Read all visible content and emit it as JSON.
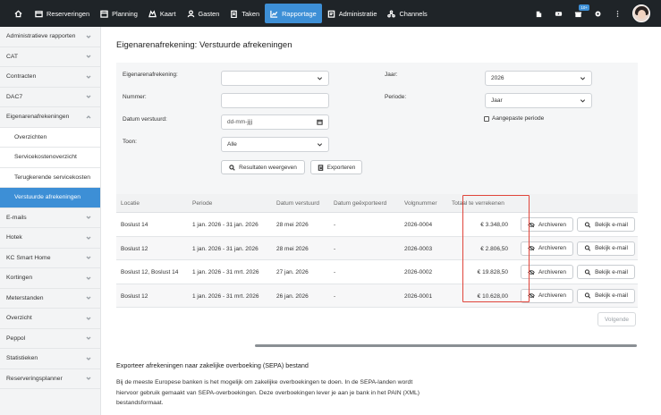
{
  "nav": {
    "items": [
      {
        "label": "Reserveringen",
        "icon": "reservations-icon"
      },
      {
        "label": "Planning",
        "icon": "planning-icon"
      },
      {
        "label": "Kaart",
        "icon": "map-icon"
      },
      {
        "label": "Gasten",
        "icon": "guests-icon"
      },
      {
        "label": "Taken",
        "icon": "tasks-icon"
      },
      {
        "label": "Rapportage",
        "icon": "chart-icon",
        "active": true
      },
      {
        "label": "Administratie",
        "icon": "admin-icon"
      },
      {
        "label": "Channels",
        "icon": "channels-icon"
      }
    ],
    "badge": "10+",
    "accent": "#3d8fd6",
    "bg": "#1f2428"
  },
  "sidebar": {
    "items": [
      {
        "label": "Administratieve rapporten"
      },
      {
        "label": "CAT"
      },
      {
        "label": "Contracten"
      },
      {
        "label": "DAC7"
      },
      {
        "label": "Eigenarenafrekeningen",
        "expanded": true
      },
      {
        "label": "Overzichten",
        "sub": true
      },
      {
        "label": "Servicekostenoverzicht",
        "sub": true
      },
      {
        "label": "Terugkerende servicekosten",
        "sub": true
      },
      {
        "label": "Verstuurde afrekeningen",
        "sub": true,
        "active": true
      },
      {
        "label": "E-mails"
      },
      {
        "label": "Hotek"
      },
      {
        "label": "KC Smart Home"
      },
      {
        "label": "Kortingen"
      },
      {
        "label": "Meterstanden"
      },
      {
        "label": "Overzicht"
      },
      {
        "label": "Peppol"
      },
      {
        "label": "Statistieken"
      },
      {
        "label": "Reserveringsplanner"
      }
    ]
  },
  "page": {
    "title": "Eigenarenafrekening: Verstuurde afrekeningen"
  },
  "filters": {
    "eigenaren_label": "Eigenarenafrekening:",
    "eigenaren_value": "",
    "nummer_label": "Nummer:",
    "nummer_value": "",
    "datum_label": "Datum verstuurd:",
    "datum_placeholder": "dd-mm-jjjj",
    "toon_label": "Toon:",
    "toon_value": "Alle",
    "jaar_label": "Jaar:",
    "jaar_value": "2026",
    "periode_label": "Periode:",
    "periode_value": "Jaar",
    "aangepaste_label": "Aangepaste periode",
    "show_results_label": "Resultaten weergeven",
    "export_label": "Exporteren"
  },
  "table": {
    "headers": [
      "Locatie",
      "Periode",
      "Datum verstuurd",
      "Datum geëxporteerd",
      "Volgnummer",
      "Totaal te verrekenen"
    ],
    "rows": [
      {
        "locatie": "Boslust 14",
        "periode": "1 jan. 2026 - 31 jan. 2026",
        "datum": "28 mei 2026",
        "export": "-",
        "volgnummer": "2026-0004",
        "totaal": "€ 3.348,00"
      },
      {
        "locatie": "Boslust 12",
        "periode": "1 jan. 2026 - 31 jan. 2026",
        "datum": "28 mei 2026",
        "export": "-",
        "volgnummer": "2026-0003",
        "totaal": "€ 2.806,50"
      },
      {
        "locatie": "Boslust 12, Boslust 14",
        "periode": "1 jan. 2026 - 31 mrt. 2026",
        "datum": "27 jan. 2026",
        "export": "-",
        "volgnummer": "2026-0002",
        "totaal": "€ 19.828,50"
      },
      {
        "locatie": "Boslust 12",
        "periode": "1 jan. 2026 - 31 mrt. 2026",
        "datum": "26 jan. 2026",
        "export": "-",
        "volgnummer": "2026-0001",
        "totaal": "€ 10.628,00"
      }
    ],
    "archive_label": "Archiveren",
    "email_label": "Bekijk e-mail",
    "next_label": "Volgende",
    "highlight_color": "#e0453b"
  },
  "sepa": {
    "title": "Exporteer afrekeningen naar zakelijke overboeking (SEPA) bestand",
    "line1": "Bij de meeste Europese banken is het mogelijk om zakelijke overboekingen te doen. In de SEPA-landen wordt",
    "line2": "hiervoor gebruik gemaakt van SEPA-overboekingen. Deze overboekingen lever je aan je bank in het PAIN (XML)",
    "line3": "bestandsformaat."
  }
}
